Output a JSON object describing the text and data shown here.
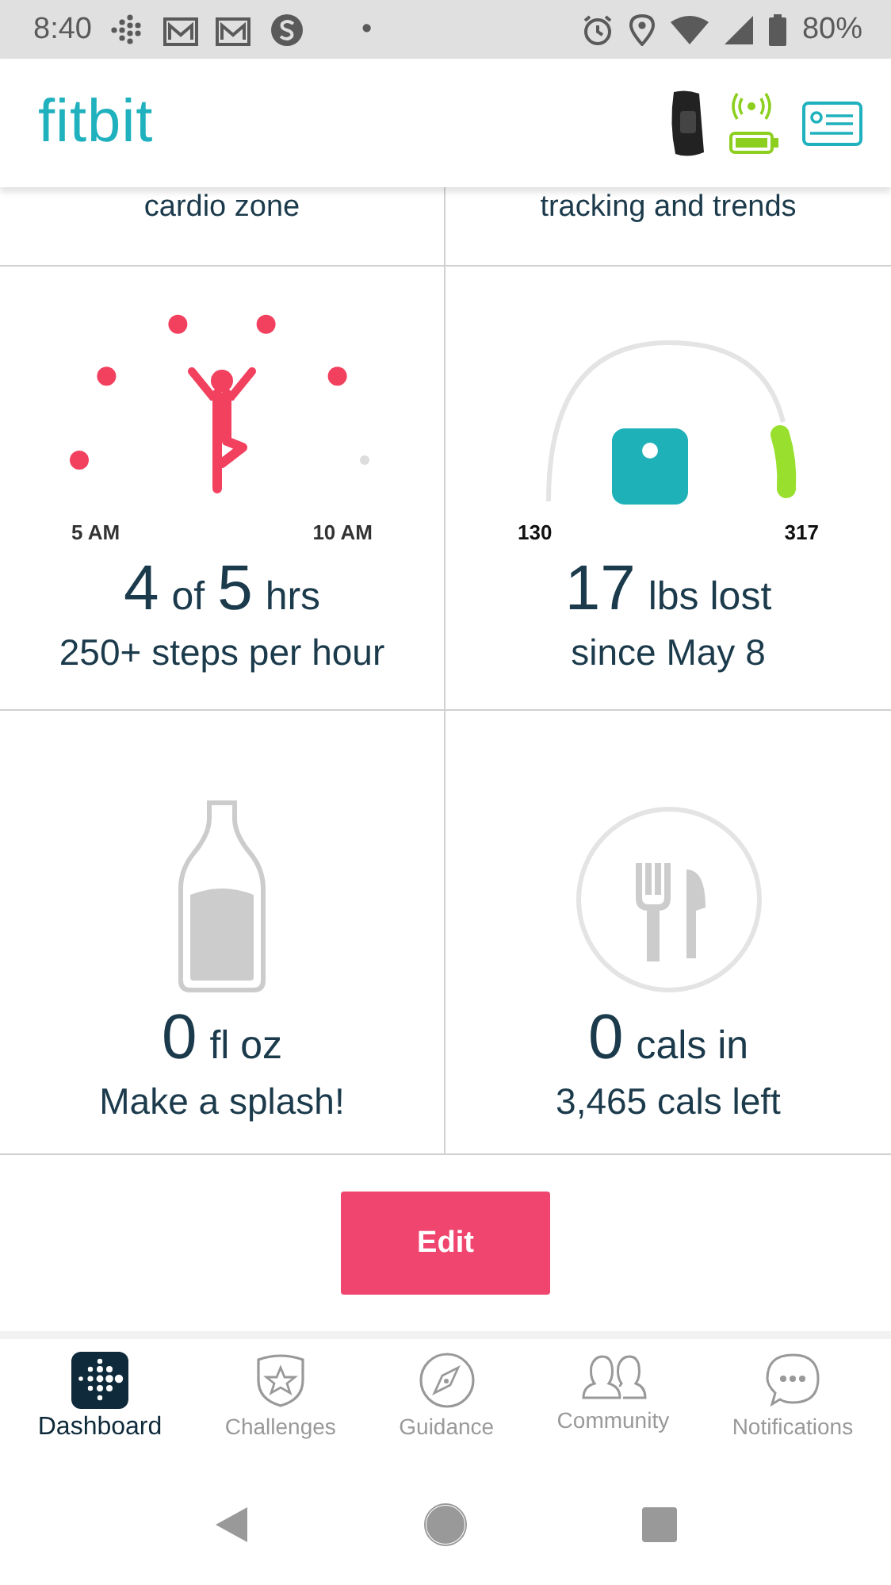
{
  "status_bar": {
    "time": "8:40",
    "dot": "•",
    "battery": "80%"
  },
  "header": {
    "logo": "fitbit"
  },
  "tiles_cut": [
    {
      "text": "cardio zone"
    },
    {
      "text": "tracking and trends"
    }
  ],
  "hourly": {
    "hours": [
      {
        "met": true
      },
      {
        "met": true
      },
      {
        "met": true
      },
      {
        "met": true
      },
      {
        "met": true
      },
      {
        "met": false
      }
    ],
    "start": "5 AM",
    "end": "10 AM",
    "value": "4",
    "of": "of",
    "goal": "5",
    "unit": "hrs",
    "caption": "250+ steps per hour"
  },
  "weight": {
    "start": "130",
    "end": "317",
    "value": "17",
    "unit": "lbs lost",
    "caption": "since May 8"
  },
  "water": {
    "value": "0",
    "unit": "fl oz",
    "caption": "Make a splash!"
  },
  "food": {
    "value": "0",
    "unit": "cals in",
    "caption": "3,465 cals left"
  },
  "edit_button": "Edit",
  "tabs": [
    {
      "label": "Dashboard",
      "kind": "dashboard",
      "selected": true
    },
    {
      "label": "Challenges",
      "kind": "challenges",
      "selected": false
    },
    {
      "label": "Guidance",
      "kind": "guidance",
      "selected": false
    },
    {
      "label": "Community",
      "kind": "community",
      "selected": false
    },
    {
      "label": "Notifications",
      "kind": "notifications",
      "selected": false
    }
  ]
}
